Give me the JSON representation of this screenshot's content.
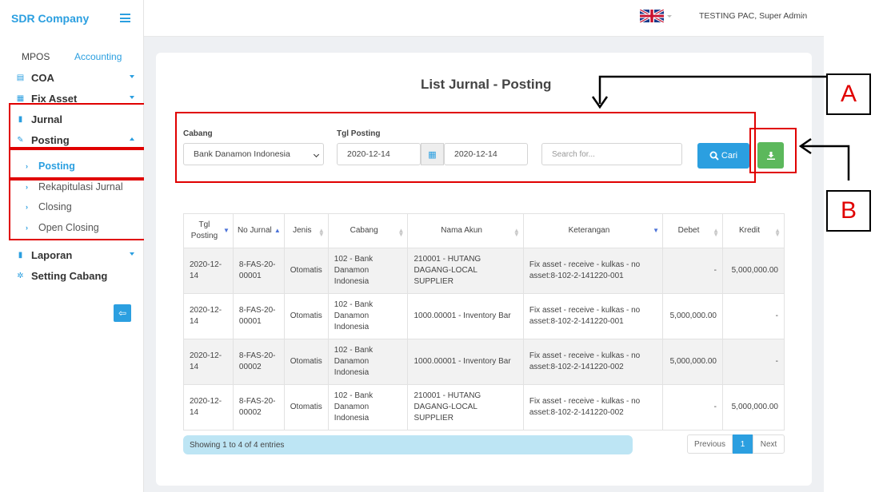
{
  "app": {
    "brand": "SDR Company"
  },
  "sidebar": {
    "tabs": [
      {
        "label": "MPOS"
      },
      {
        "label": "Accounting"
      }
    ],
    "items": [
      {
        "label": "COA"
      },
      {
        "label": "Fix Asset"
      },
      {
        "label": "Jurnal"
      },
      {
        "label": "Posting"
      },
      {
        "label": "Laporan"
      },
      {
        "label": "Setting Cabang"
      }
    ],
    "posting_sub": [
      {
        "label": "Posting"
      },
      {
        "label": "Rekapitulasi Jurnal"
      },
      {
        "label": "Closing"
      },
      {
        "label": "Open Closing"
      }
    ]
  },
  "topbar": {
    "user": "TESTING PAC, Super Admin",
    "language_icon": "uk-flag-icon"
  },
  "page": {
    "title": "List Jurnal - Posting"
  },
  "filters": {
    "cabang_label": "Cabang",
    "cabang_value": "Bank Danamon Indonesia",
    "tgl_label": "Tgl Posting",
    "date_from": "2020-12-14",
    "date_to": "2020-12-14",
    "search_placeholder": "Search for...",
    "cari_label": "Cari"
  },
  "callouts": {
    "a": "A",
    "b": "B"
  },
  "table": {
    "headers": [
      {
        "label": "Tgl Posting",
        "sort": "desc"
      },
      {
        "label": "No Jurnal",
        "sort": "asc"
      },
      {
        "label": "Jenis",
        "sort": "none"
      },
      {
        "label": "Cabang",
        "sort": "none"
      },
      {
        "label": "Nama Akun",
        "sort": "none"
      },
      {
        "label": "Keterangan",
        "sort": "desc"
      },
      {
        "label": "Debet",
        "sort": "none"
      },
      {
        "label": "Kredit",
        "sort": "none"
      }
    ],
    "rows": [
      {
        "tgl": "2020-12-14",
        "no": "8-FAS-20-00001",
        "jenis": "Otomatis",
        "cabang": "102 - Bank Danamon Indonesia",
        "akun": "210001 - HUTANG DAGANG-LOCAL SUPPLIER",
        "ket": "Fix asset - receive - kulkas - no asset:8-102-2-141220-001",
        "debet": "-",
        "kredit": "5,000,000.00"
      },
      {
        "tgl": "2020-12-14",
        "no": "8-FAS-20-00001",
        "jenis": "Otomatis",
        "cabang": "102 - Bank Danamon Indonesia",
        "akun": "1000.00001 - Inventory Bar",
        "ket": "Fix asset - receive - kulkas - no asset:8-102-2-141220-001",
        "debet": "5,000,000.00",
        "kredit": "-"
      },
      {
        "tgl": "2020-12-14",
        "no": "8-FAS-20-00002",
        "jenis": "Otomatis",
        "cabang": "102 - Bank Danamon Indonesia",
        "akun": "1000.00001 - Inventory Bar",
        "ket": "Fix asset - receive - kulkas - no asset:8-102-2-141220-002",
        "debet": "5,000,000.00",
        "kredit": "-"
      },
      {
        "tgl": "2020-12-14",
        "no": "8-FAS-20-00002",
        "jenis": "Otomatis",
        "cabang": "102 - Bank Danamon Indonesia",
        "akun": "210001 - HUTANG DAGANG-LOCAL SUPPLIER",
        "ket": "Fix asset - receive - kulkas - no asset:8-102-2-141220-002",
        "debet": "-",
        "kredit": "5,000,000.00"
      }
    ]
  },
  "footer": {
    "info": "Showing 1 to 4 of 4 entries",
    "prev": "Previous",
    "page": "1",
    "next": "Next"
  }
}
